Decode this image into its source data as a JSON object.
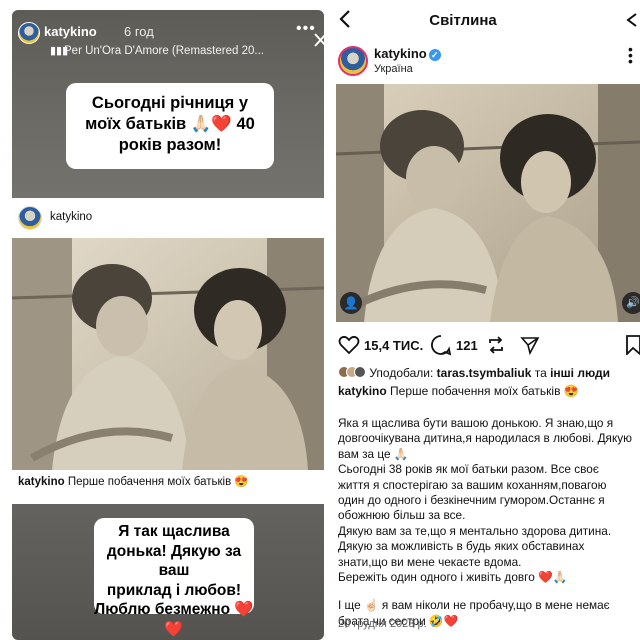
{
  "story": {
    "username": "katykino",
    "time": "6 год",
    "music_icon": "music-bars-icon",
    "music": "Per Un'Ora D'Amore (Remastered 20...",
    "sticker_top": [
      "Сьогодні річниця у",
      "моїх батьків 🙏🏻❤️ 40",
      "років разом!"
    ],
    "post_card": {
      "username": "katykino",
      "caption_user": "katykino",
      "caption_text": " Перше побачення моїх батьків 😍"
    },
    "sticker_bottom": [
      "Я так щаслива",
      "донька! Дякую за ваш",
      "приклад і любов!",
      "Люблю безмежно ❤️❤️",
      "❤️❤️❤️"
    ]
  },
  "post": {
    "title": "Світлина",
    "username": "katykino",
    "location": "Україна",
    "like_count": "15,4 ТИС.",
    "comment_count": "121",
    "likes_prefix": "Уподобали: ",
    "likes_user": "taras.tsymbaliuk",
    "likes_middle": " та ",
    "likes_others": "інші люди",
    "caption_user": "katykino",
    "caption_first": " Перше побачення моїх батьків 😍",
    "caption_lines_1": [
      "Яка я щаслива бути вашою донькою. Я знаю,що я",
      "довгоочікувана дитина,я народилася в любові. Дякую",
      "вам за це 🙏🏻",
      "Сьогодні 38 років як мої батьки разом. Все своє",
      "життя я спостерігаю за вашим коханням,повагою",
      "один до одного і безкінечним гумором.Останнє я",
      "обожнюю більш за все.",
      " Дякую вам за те,що я ментально здорова дитина.",
      "Дякую за можливість в будь яких обставинах",
      "знати,що ви мене чекаєте вдома.",
      "Бережіть один одного і живіть довго ❤️🙏🏻"
    ],
    "caption_lines_2": [
      "І ще ☝🏻 я вам ніколи не пробачу,що в мене немає",
      "брата чи сестри 🤣❤️"
    ],
    "date": "20 грудня 2023 р."
  },
  "colors": {
    "accent_blue": "#3897f0",
    "heart_red": "#e02a2a",
    "story_ring": "#e1306c"
  }
}
